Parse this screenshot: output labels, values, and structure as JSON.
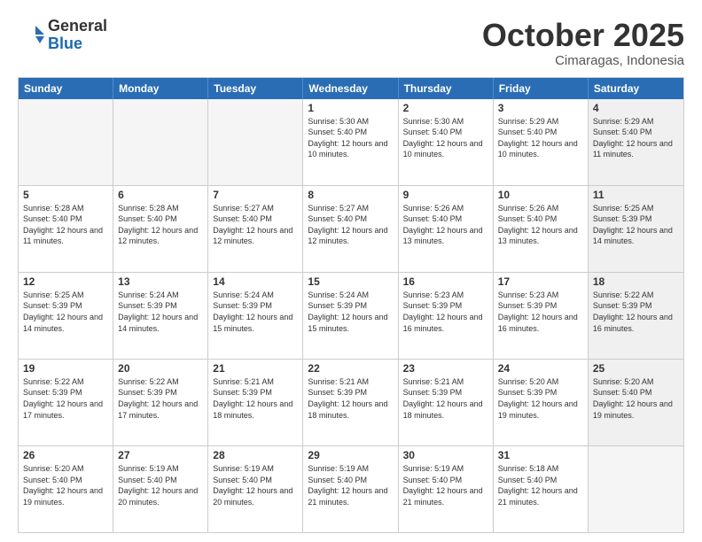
{
  "header": {
    "logo": {
      "general": "General",
      "blue": "Blue"
    },
    "title": "October 2025",
    "location": "Cimaragas, Indonesia"
  },
  "weekdays": [
    "Sunday",
    "Monday",
    "Tuesday",
    "Wednesday",
    "Thursday",
    "Friday",
    "Saturday"
  ],
  "weeks": [
    [
      {
        "day": "",
        "info": "",
        "empty": true
      },
      {
        "day": "",
        "info": "",
        "empty": true
      },
      {
        "day": "",
        "info": "",
        "empty": true
      },
      {
        "day": "1",
        "info": "Sunrise: 5:30 AM\nSunset: 5:40 PM\nDaylight: 12 hours\nand 10 minutes."
      },
      {
        "day": "2",
        "info": "Sunrise: 5:30 AM\nSunset: 5:40 PM\nDaylight: 12 hours\nand 10 minutes."
      },
      {
        "day": "3",
        "info": "Sunrise: 5:29 AM\nSunset: 5:40 PM\nDaylight: 12 hours\nand 10 minutes."
      },
      {
        "day": "4",
        "info": "Sunrise: 5:29 AM\nSunset: 5:40 PM\nDaylight: 12 hours\nand 11 minutes.",
        "shaded": true
      }
    ],
    [
      {
        "day": "5",
        "info": "Sunrise: 5:28 AM\nSunset: 5:40 PM\nDaylight: 12 hours\nand 11 minutes."
      },
      {
        "day": "6",
        "info": "Sunrise: 5:28 AM\nSunset: 5:40 PM\nDaylight: 12 hours\nand 12 minutes."
      },
      {
        "day": "7",
        "info": "Sunrise: 5:27 AM\nSunset: 5:40 PM\nDaylight: 12 hours\nand 12 minutes."
      },
      {
        "day": "8",
        "info": "Sunrise: 5:27 AM\nSunset: 5:40 PM\nDaylight: 12 hours\nand 12 minutes."
      },
      {
        "day": "9",
        "info": "Sunrise: 5:26 AM\nSunset: 5:40 PM\nDaylight: 12 hours\nand 13 minutes."
      },
      {
        "day": "10",
        "info": "Sunrise: 5:26 AM\nSunset: 5:40 PM\nDaylight: 12 hours\nand 13 minutes."
      },
      {
        "day": "11",
        "info": "Sunrise: 5:25 AM\nSunset: 5:39 PM\nDaylight: 12 hours\nand 14 minutes.",
        "shaded": true
      }
    ],
    [
      {
        "day": "12",
        "info": "Sunrise: 5:25 AM\nSunset: 5:39 PM\nDaylight: 12 hours\nand 14 minutes."
      },
      {
        "day": "13",
        "info": "Sunrise: 5:24 AM\nSunset: 5:39 PM\nDaylight: 12 hours\nand 14 minutes."
      },
      {
        "day": "14",
        "info": "Sunrise: 5:24 AM\nSunset: 5:39 PM\nDaylight: 12 hours\nand 15 minutes."
      },
      {
        "day": "15",
        "info": "Sunrise: 5:24 AM\nSunset: 5:39 PM\nDaylight: 12 hours\nand 15 minutes."
      },
      {
        "day": "16",
        "info": "Sunrise: 5:23 AM\nSunset: 5:39 PM\nDaylight: 12 hours\nand 16 minutes."
      },
      {
        "day": "17",
        "info": "Sunrise: 5:23 AM\nSunset: 5:39 PM\nDaylight: 12 hours\nand 16 minutes."
      },
      {
        "day": "18",
        "info": "Sunrise: 5:22 AM\nSunset: 5:39 PM\nDaylight: 12 hours\nand 16 minutes.",
        "shaded": true
      }
    ],
    [
      {
        "day": "19",
        "info": "Sunrise: 5:22 AM\nSunset: 5:39 PM\nDaylight: 12 hours\nand 17 minutes."
      },
      {
        "day": "20",
        "info": "Sunrise: 5:22 AM\nSunset: 5:39 PM\nDaylight: 12 hours\nand 17 minutes."
      },
      {
        "day": "21",
        "info": "Sunrise: 5:21 AM\nSunset: 5:39 PM\nDaylight: 12 hours\nand 18 minutes."
      },
      {
        "day": "22",
        "info": "Sunrise: 5:21 AM\nSunset: 5:39 PM\nDaylight: 12 hours\nand 18 minutes."
      },
      {
        "day": "23",
        "info": "Sunrise: 5:21 AM\nSunset: 5:39 PM\nDaylight: 12 hours\nand 18 minutes."
      },
      {
        "day": "24",
        "info": "Sunrise: 5:20 AM\nSunset: 5:39 PM\nDaylight: 12 hours\nand 19 minutes."
      },
      {
        "day": "25",
        "info": "Sunrise: 5:20 AM\nSunset: 5:40 PM\nDaylight: 12 hours\nand 19 minutes.",
        "shaded": true
      }
    ],
    [
      {
        "day": "26",
        "info": "Sunrise: 5:20 AM\nSunset: 5:40 PM\nDaylight: 12 hours\nand 19 minutes."
      },
      {
        "day": "27",
        "info": "Sunrise: 5:19 AM\nSunset: 5:40 PM\nDaylight: 12 hours\nand 20 minutes."
      },
      {
        "day": "28",
        "info": "Sunrise: 5:19 AM\nSunset: 5:40 PM\nDaylight: 12 hours\nand 20 minutes."
      },
      {
        "day": "29",
        "info": "Sunrise: 5:19 AM\nSunset: 5:40 PM\nDaylight: 12 hours\nand 21 minutes."
      },
      {
        "day": "30",
        "info": "Sunrise: 5:19 AM\nSunset: 5:40 PM\nDaylight: 12 hours\nand 21 minutes."
      },
      {
        "day": "31",
        "info": "Sunrise: 5:18 AM\nSunset: 5:40 PM\nDaylight: 12 hours\nand 21 minutes."
      },
      {
        "day": "",
        "info": "",
        "empty": true,
        "shaded": true
      }
    ]
  ]
}
